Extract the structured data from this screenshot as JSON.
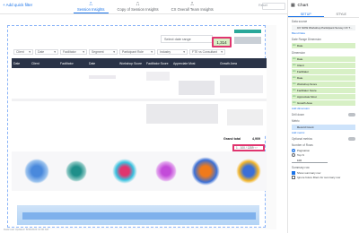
{
  "topbar": {
    "add_filter": "+ Add quick filter",
    "tabs": [
      {
        "label": "Session Insights",
        "icon": "chart-icon"
      },
      {
        "label": "Copy of Session Insights",
        "icon": "chart-icon"
      },
      {
        "label": "CX Overall Team Insights",
        "icon": "chart-icon"
      }
    ],
    "reset": "Reset"
  },
  "report": {
    "date_range_placeholder": "Select date range",
    "kpi_value": "1,314",
    "filters": [
      "Client",
      "Date",
      "Facilitator",
      "Segment",
      "Participant Role",
      "Industry",
      "FTE vs Consultant"
    ],
    "table_headers": [
      "Date",
      "Client",
      "Facilitator",
      "Date",
      "Workshop Score",
      "Facilitator Score",
      "Appreciate Most",
      "Growth Area"
    ],
    "grand_total_label": "Grand total",
    "grand_total_value": "4,909",
    "pager": "1 - 100 / 1359",
    "footer": "Data Last Updated: 8/30/2024 12:00 AM"
  },
  "panel": {
    "title": "Chart",
    "tabs": [
      "SETUP",
      "STYLE"
    ],
    "data_source_label": "Data source",
    "data_source": "CX SOW Workshop Participant Survey CX T...",
    "blend": "Blend Data",
    "date_range_dim_label": "Date Range Dimension",
    "date_range_dim": "Date",
    "dimension_label": "Dimension",
    "dimensions": [
      "Date",
      "Client",
      "Facilitator",
      "Date",
      "Workshop Score",
      "Facilitator Score",
      "Appreciate Most",
      "Growth Area"
    ],
    "add_dimension": "Add dimension",
    "drill_down_label": "Drill down",
    "metric_label": "Metric",
    "metrics": [
      "Record Count"
    ],
    "add_metric": "Add metric",
    "optional_metrics": "Optional metrics",
    "rows_label": "Number of Rows",
    "rows_options": [
      "Pagination",
      "Top N"
    ],
    "rows_per_page": "100",
    "summary_label": "Summary row",
    "summary_options": [
      "Show summary row",
      "Ignore future filters for summary row"
    ]
  }
}
